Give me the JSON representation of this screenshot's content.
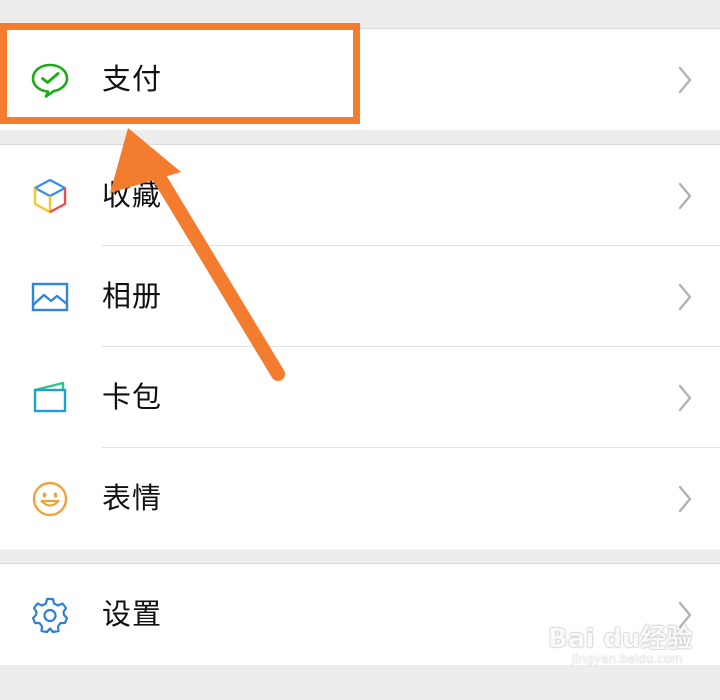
{
  "menu": {
    "groups": [
      {
        "items": [
          {
            "label": "支付",
            "icon": "wechat-pay-icon",
            "color": "#1aad19"
          }
        ]
      },
      {
        "items": [
          {
            "label": "收藏",
            "icon": "favorites-cube-icon",
            "color": "#3b8ee9"
          },
          {
            "label": "相册",
            "icon": "album-icon",
            "color": "#2e86de"
          },
          {
            "label": "卡包",
            "icon": "card-wallet-icon",
            "color": "#1aa0e0"
          },
          {
            "label": "表情",
            "icon": "sticker-smile-icon",
            "color": "#f0a23b"
          }
        ]
      },
      {
        "items": [
          {
            "label": "设置",
            "icon": "gear-icon",
            "color": "#2d7fd8"
          }
        ]
      }
    ]
  },
  "annotation": {
    "color": "#f47c2e",
    "highlight_target": "支付"
  },
  "watermark": {
    "text": "Bai du经验",
    "sub": "jingyan.baidu.com"
  }
}
